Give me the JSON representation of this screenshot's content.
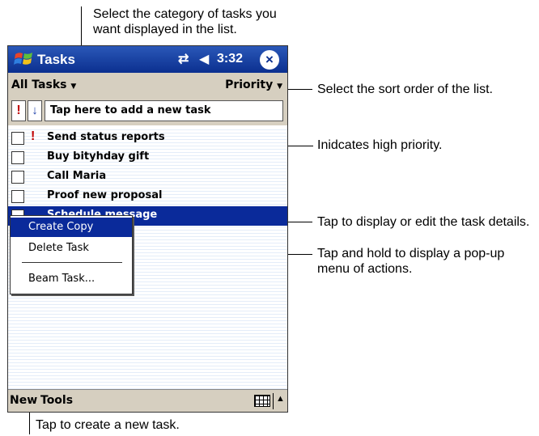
{
  "window": {
    "title": "Tasks",
    "clock": "3:32",
    "start_icon": "windows-flag-icon",
    "connectivity_icon": "connectivity-icon",
    "volume_icon": "speaker-icon",
    "close_label": "×"
  },
  "filter": {
    "category": "All Tasks",
    "category_arrow": "▼",
    "sort": "Priority",
    "sort_arrow": "▼"
  },
  "entry_bar": {
    "priority_glyph": "!",
    "sort_glyph": "↓",
    "placeholder": "Tap here to add a new task"
  },
  "tasks": [
    {
      "label": "Send status reports",
      "high_priority": true,
      "selected": false
    },
    {
      "label": "Buy bityhday gift",
      "high_priority": false,
      "selected": false
    },
    {
      "label": "Call Maria",
      "high_priority": false,
      "selected": false
    },
    {
      "label": "Proof new proposal",
      "high_priority": false,
      "selected": false
    },
    {
      "label": "Schedule message",
      "high_priority": false,
      "selected": true
    }
  ],
  "popup_menu": {
    "items": [
      "Create Copy",
      "Delete Task",
      "Beam Task..."
    ],
    "highlighted": "Create Copy"
  },
  "command_bar": {
    "new_label": "New",
    "tools_label": "Tools",
    "sip_arrow": "▲"
  },
  "annotations": {
    "category": "Select the category of tasks you want displayed in the list.",
    "sort": "Select the sort order of the list.",
    "priority": "Inidcates high priority.",
    "details": "Tap to display or edit the task details.",
    "popup": "Tap and hold to display a pop-up menu of actions.",
    "new": "Tap to create a new task."
  },
  "colors": {
    "title_bar": "#0b2f8f",
    "selection": "#0a2a9a",
    "bars": "#d6cfc0",
    "priority_red": "#c00000"
  }
}
